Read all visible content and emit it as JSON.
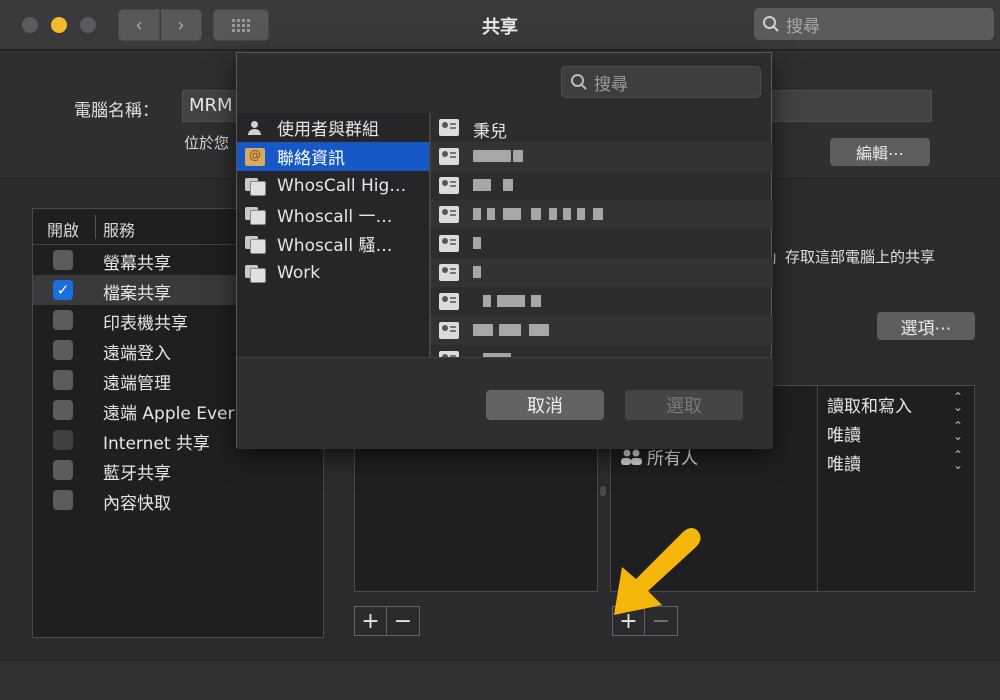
{
  "window": {
    "title": "共享",
    "search_placeholder": "搜尋"
  },
  "computer_name": {
    "label": "電腦名稱：",
    "value": "MRM",
    "located_text": "位於您",
    "edit_button": "編輯⋯"
  },
  "services": {
    "header_on": "開啟",
    "header_service": "服務",
    "items": [
      {
        "label": "螢幕共享",
        "checked": false,
        "selected": false
      },
      {
        "label": "檔案共享",
        "checked": true,
        "selected": true
      },
      {
        "label": "印表機共享",
        "checked": false,
        "selected": false
      },
      {
        "label": "遠端登入",
        "checked": false,
        "selected": false
      },
      {
        "label": "遠端管理",
        "checked": false,
        "selected": false
      },
      {
        "label": "遠端 Apple Ever",
        "checked": false,
        "selected": false
      },
      {
        "label": "Internet 共享",
        "checked": false,
        "selected": false
      },
      {
        "label": "藍牙共享",
        "checked": false,
        "selected": false
      },
      {
        "label": "內容快取",
        "checked": false,
        "selected": false
      }
    ]
  },
  "status": {
    "access_text": "」存取這部電腦上的共享",
    "options_button": "選項⋯"
  },
  "users": {
    "everyone": "所有人",
    "permissions": [
      "讀取和寫入",
      "唯讀",
      "唯讀"
    ]
  },
  "controls": {
    "plus": "+",
    "minus": "−"
  },
  "sheet": {
    "search_placeholder": "搜尋",
    "sources": [
      {
        "label": "使用者與群組",
        "icon": "users-icon",
        "selected": false
      },
      {
        "label": "聯絡資訊",
        "icon": "address-book-icon",
        "selected": true
      },
      {
        "label": "WhosCall Hig…",
        "icon": "contact-group-icon",
        "selected": false
      },
      {
        "label": "Whoscall 一…",
        "icon": "contact-group-icon",
        "selected": false
      },
      {
        "label": "Whoscall 騷…",
        "icon": "contact-group-icon",
        "selected": false
      },
      {
        "label": "Work",
        "icon": "contact-group-icon",
        "selected": false
      }
    ],
    "contacts": [
      "秉兒"
    ],
    "cancel_button": "取消",
    "choose_button": "選取"
  },
  "colors": {
    "accent": "#1658c6",
    "annotation_arrow": "#f5b60a"
  }
}
